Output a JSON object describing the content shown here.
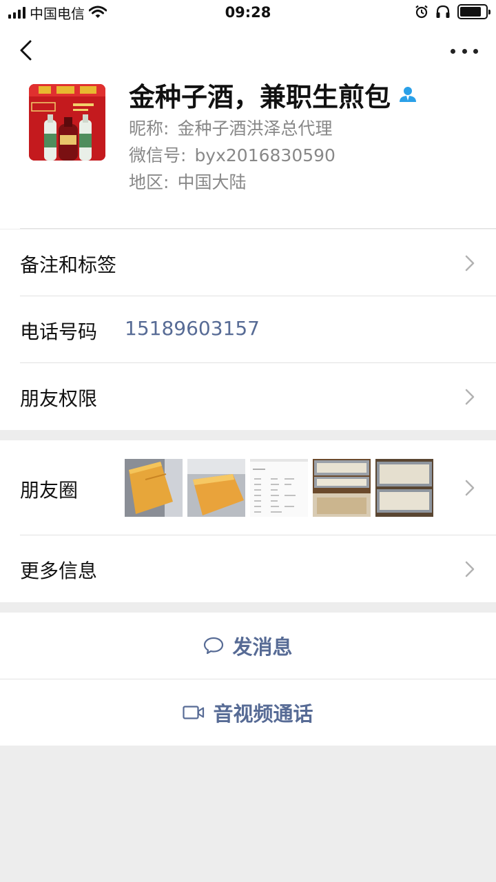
{
  "status_bar": {
    "carrier": "中国电信",
    "time": "09:28"
  },
  "profile": {
    "name": "金种子酒，兼职生煎包",
    "nickname_label": "昵称:",
    "nickname": "金种子酒洪泽总代理",
    "wechat_id_label": "微信号:",
    "wechat_id": "byx2016830590",
    "region_label": "地区:",
    "region": "中国大陆"
  },
  "rows": {
    "remarks_tags": "备注和标签",
    "phone_label": "电话号码",
    "phone_number": "15189603157",
    "friend_permissions": "朋友权限",
    "moments": "朋友圈",
    "more_info": "更多信息"
  },
  "actions": {
    "send_message": "发消息",
    "video_call": "音视频通话"
  },
  "colors": {
    "link_blue": "#576b95",
    "background_gray": "#ededed",
    "divider": "#e2e2e2",
    "verified_blue": "#2aa0e8"
  }
}
